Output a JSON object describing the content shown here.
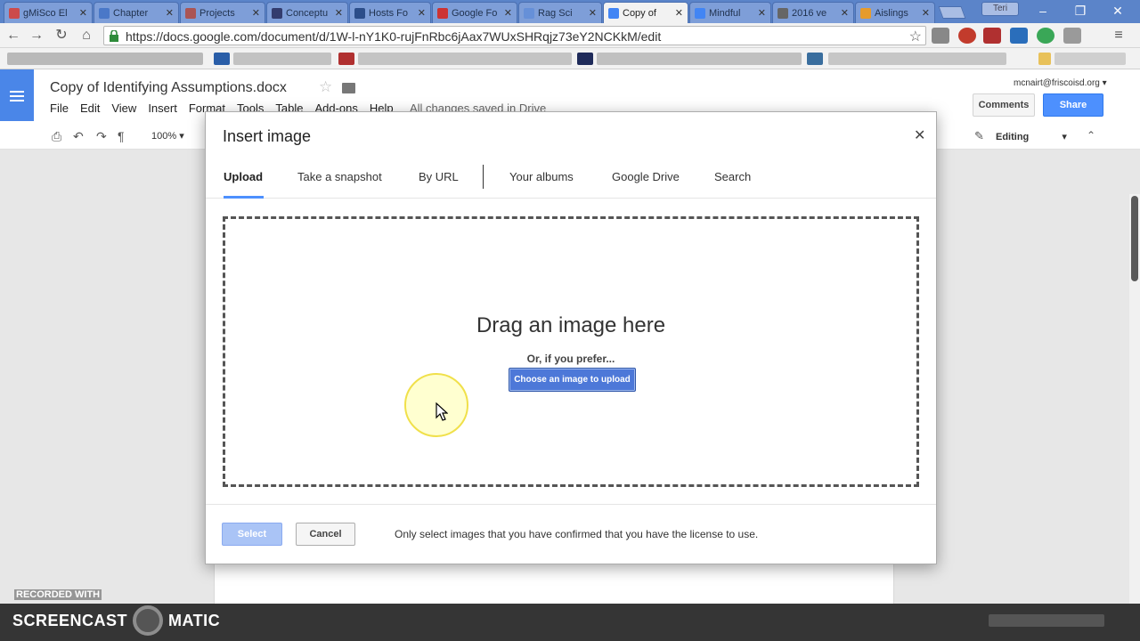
{
  "browser": {
    "tabs": [
      {
        "label": "gMiSco El",
        "color": "#cc4b4b",
        "active": false
      },
      {
        "label": "Chapter",
        "color": "#4a78c8",
        "active": false
      },
      {
        "label": "Projects",
        "color": "#aa5555",
        "active": false
      },
      {
        "label": "Conceptu",
        "color": "#333c6e",
        "active": false
      },
      {
        "label": "Hosts Fo",
        "color": "#2c4e8a",
        "active": false
      },
      {
        "label": "Google Fo",
        "color": "#cc3333",
        "active": false
      },
      {
        "label": "Rag Sci",
        "color": "#6690d8",
        "active": false
      },
      {
        "label": "Copy of",
        "color": "#4285f4",
        "active": true
      },
      {
        "label": "Mindful",
        "color": "#4285f4",
        "active": false
      },
      {
        "label": "2016 ve",
        "color": "#666666",
        "active": false
      },
      {
        "label": "Aislings",
        "color": "#e69b2c",
        "active": false
      }
    ],
    "profile_label": "Teri",
    "url": "https://docs.google.com/document/d/1W-l-nY1K0-rujFnRbc6jAax7WUxSHRqjz73eY2NCKkM/edit"
  },
  "docs": {
    "title": "Copy of Identifying Assumptions.docx",
    "menu": [
      "File",
      "Edit",
      "View",
      "Insert",
      "Format",
      "Tools",
      "Table",
      "Add-ons",
      "Help"
    ],
    "save_status": "All changes saved in Drive",
    "account": "mcnairt@friscoisd.org",
    "comments_label": "Comments",
    "share_label": "Share",
    "zoom": "100%",
    "mode": "Editing"
  },
  "dialog": {
    "title": "Insert image",
    "tabs": [
      "Upload",
      "Take a snapshot",
      "By URL",
      "Your albums",
      "Google Drive",
      "Search"
    ],
    "active_tab": "Upload",
    "drop_title": "Drag an image here",
    "drop_sub": "Or, if you prefer...",
    "choose_label": "Choose an image to upload",
    "select_label": "Select",
    "cancel_label": "Cancel",
    "license_text": "Only select images that you have confirmed that you have the license to use."
  },
  "watermark": {
    "recorded": "RECORDED WITH",
    "brand_left": "SCREENCAST",
    "brand_right": "MATIC"
  }
}
